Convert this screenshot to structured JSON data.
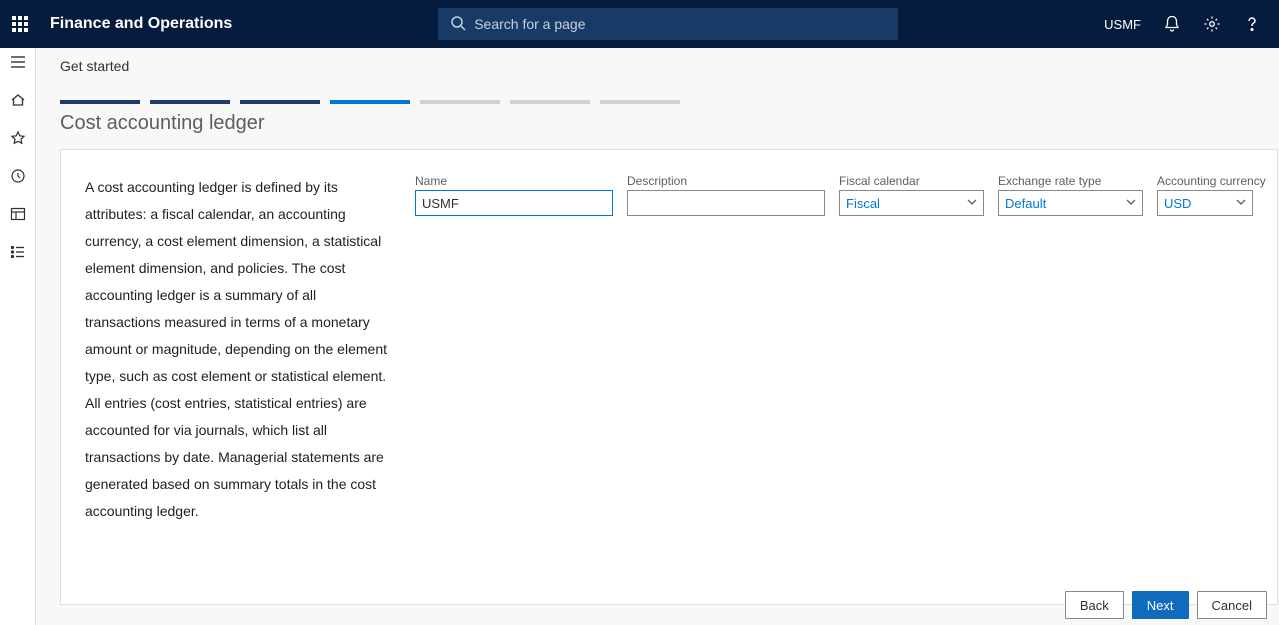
{
  "header": {
    "brand": "Finance and Operations",
    "search_placeholder": "Search for a page",
    "entity": "USMF"
  },
  "breadcrumb": "Get started",
  "page_title": "Cost accounting ledger",
  "description": "A cost accounting ledger is defined by its attributes: a fiscal calendar, an accounting currency, a cost element dimension, a statistical element dimension, and policies. The cost accounting ledger is a summary of all transactions measured in terms of a monetary amount or magnitude, depending on the element type, such as cost element or statistical element. All entries (cost entries, statistical entries) are accounted for via journals, which list all transactions by date. Managerial statements are generated based on summary totals in the cost accounting ledger.",
  "fields": {
    "name": {
      "label": "Name",
      "value": "USMF"
    },
    "description": {
      "label": "Description",
      "value": ""
    },
    "fiscal_calendar": {
      "label": "Fiscal calendar",
      "value": "Fiscal"
    },
    "exchange_rate_type": {
      "label": "Exchange rate type",
      "value": "Default"
    },
    "accounting_currency": {
      "label": "Accounting currency",
      "value": "USD"
    }
  },
  "buttons": {
    "back": "Back",
    "next": "Next",
    "cancel": "Cancel"
  },
  "progress": {
    "total": 7,
    "completed": 3,
    "active_index": 3
  },
  "icons": {
    "search": "search-icon",
    "bell": "bell-icon",
    "gear": "gear-icon",
    "help": "help-icon",
    "menu": "menu-icon",
    "home": "home-icon",
    "star": "star-icon",
    "recent": "recent-icon",
    "module": "module-icon",
    "list": "list-icon"
  }
}
